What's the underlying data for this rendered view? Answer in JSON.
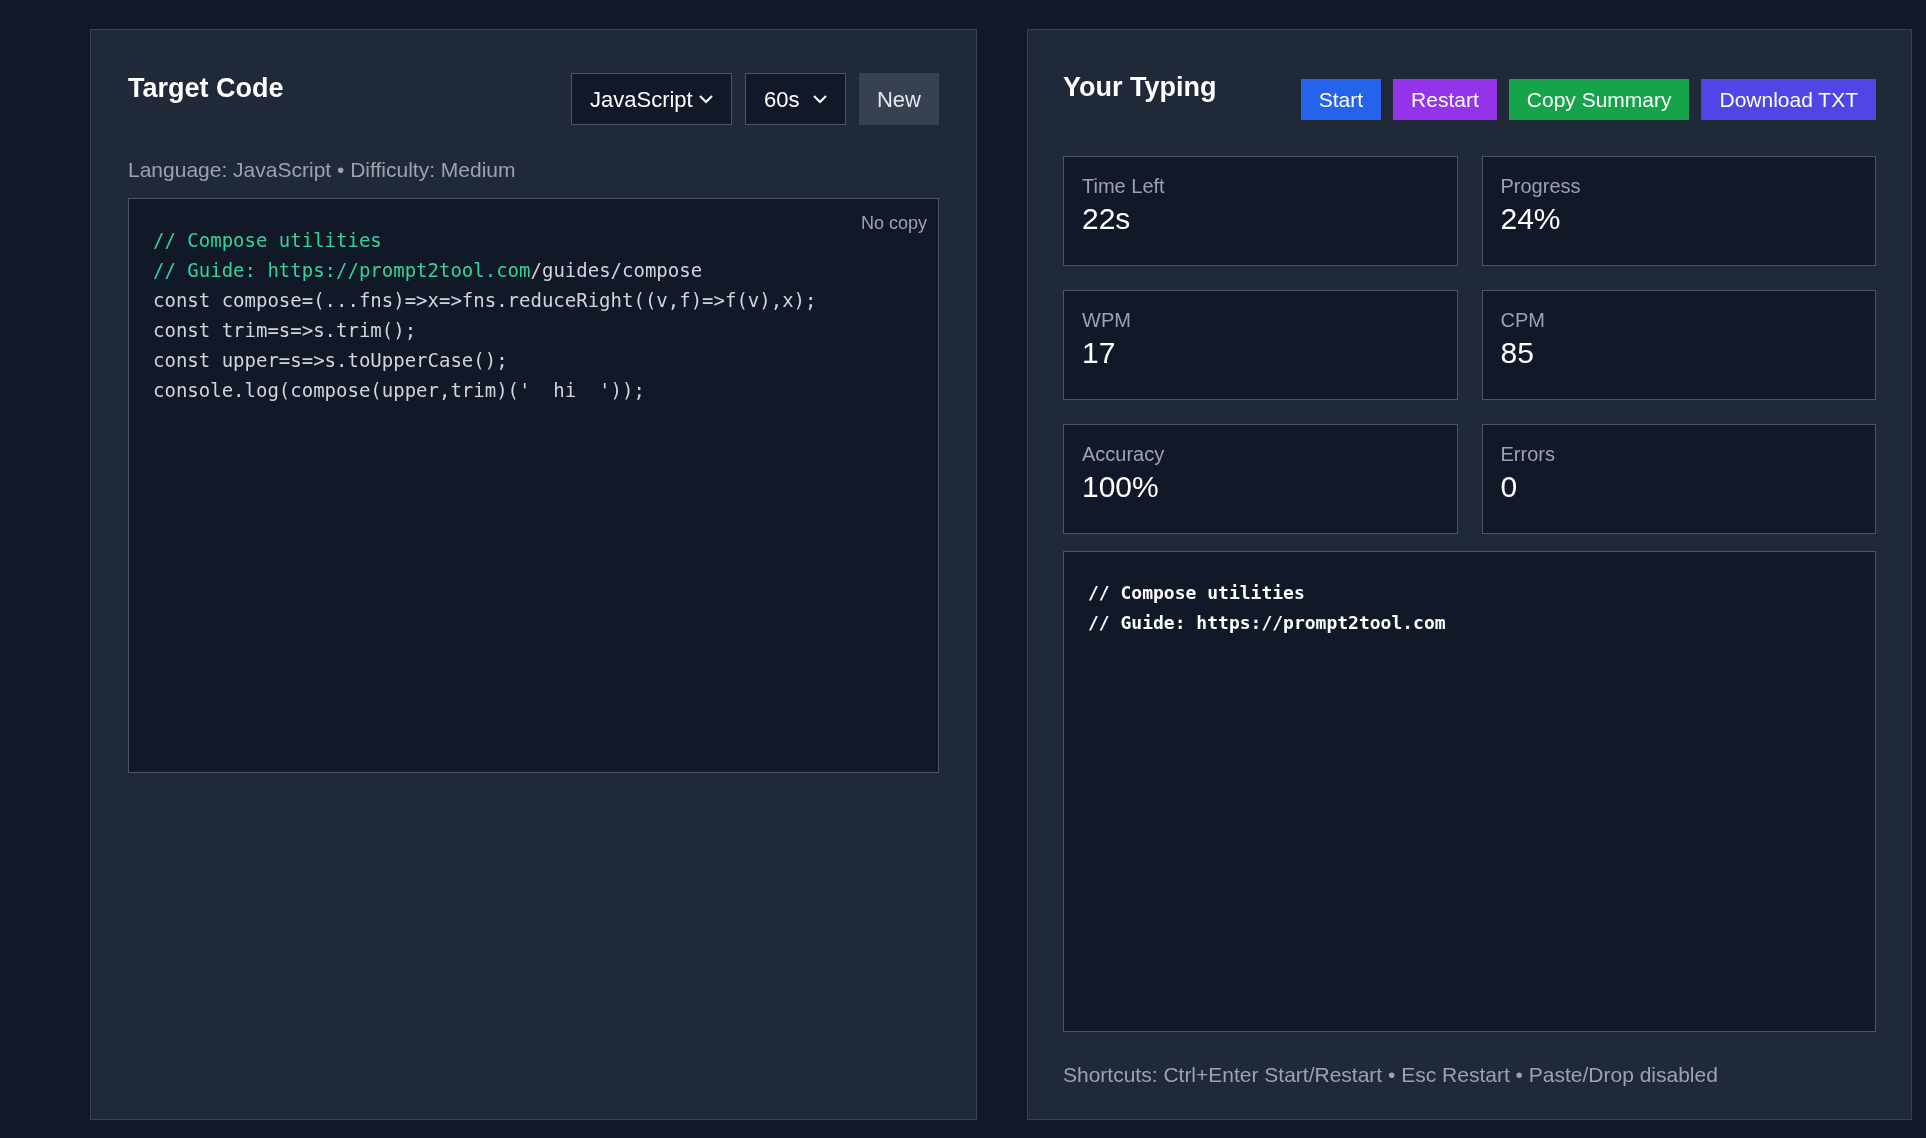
{
  "target": {
    "title": "Target Code",
    "language_select": {
      "value": "JavaScript"
    },
    "duration_select": {
      "value": "60s"
    },
    "new_button": "New",
    "info": "Language: JavaScript • Difficulty: Medium",
    "no_copy_label": "No copy",
    "code_lines": [
      [
        {
          "text": "// Compose utilities",
          "typed": true
        }
      ],
      [
        {
          "text": "// Guide: https://prompt2tool.com",
          "typed": true
        },
        {
          "text": "/guides/compose",
          "typed": false
        }
      ],
      [
        {
          "text": "const compose=(...fns)=>x=>fns.reduceRight((v,f)=>f(v),x);",
          "typed": false
        }
      ],
      [
        {
          "text": "const trim=s=>s.trim();",
          "typed": false
        }
      ],
      [
        {
          "text": "const upper=s=>s.toUpperCase();",
          "typed": false
        }
      ],
      [
        {
          "text": "console.log(compose(upper,trim)('  hi  '));",
          "typed": false
        }
      ]
    ]
  },
  "typing": {
    "title": "Your Typing",
    "buttons": [
      {
        "label": "Start",
        "color": "#2563eb"
      },
      {
        "label": "Restart",
        "color": "#9333ea"
      },
      {
        "label": "Copy Summary",
        "color": "#16a34a"
      },
      {
        "label": "Download TXT",
        "color": "#4f46e5"
      }
    ],
    "stats": [
      {
        "label": "Time Left",
        "value": "22s"
      },
      {
        "label": "Progress",
        "value": "24%"
      },
      {
        "label": "WPM",
        "value": "17"
      },
      {
        "label": "CPM",
        "value": "85"
      },
      {
        "label": "Accuracy",
        "value": "100%"
      },
      {
        "label": "Errors",
        "value": "0"
      }
    ],
    "input": {
      "value": "// Compose utilities\n// Guide: https://prompt2tool.com"
    },
    "shortcuts": "Shortcuts: Ctrl+Enter Start/Restart • Esc Restart • Paste/Drop disabled"
  }
}
